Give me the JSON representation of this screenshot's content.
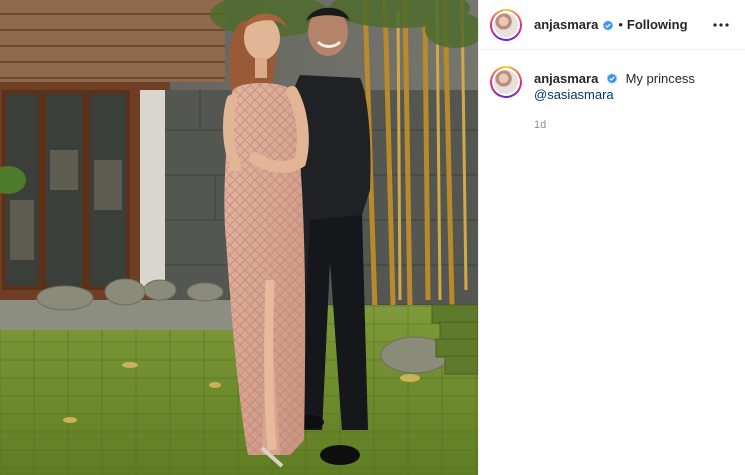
{
  "post": {
    "author": "anjasmara",
    "follow_status": "Following",
    "separator": "•",
    "caption_text": "My princess",
    "mention": "@sasiasmara",
    "time_ago": "1d"
  },
  "icons": {
    "header_avatar": "profile-avatar",
    "verified": "verified-badge-icon",
    "more": "more-options-icon"
  },
  "colors": {
    "verified_blue": "#3897f0",
    "mention_link": "#00376b",
    "muted_text": "#8e8e8e",
    "primary_text": "#262626"
  }
}
